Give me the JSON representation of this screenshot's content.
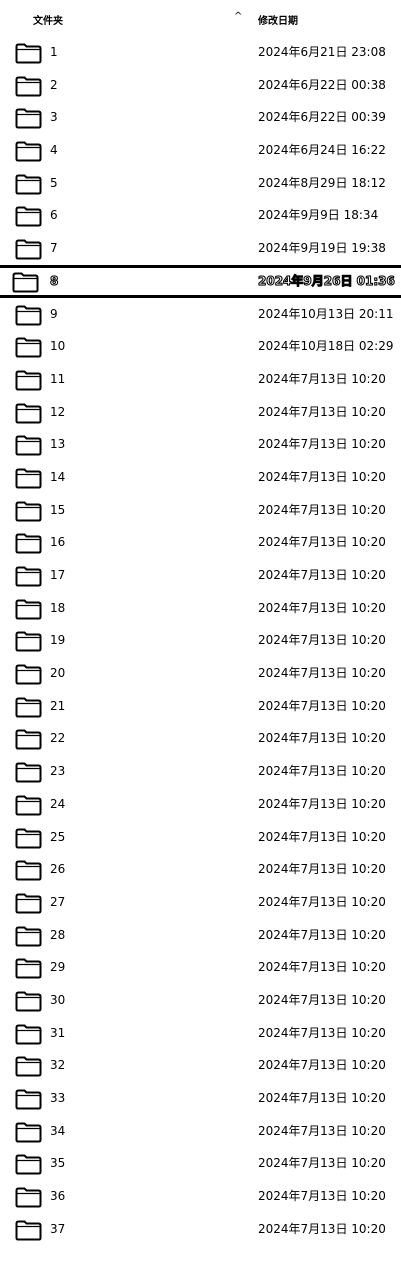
{
  "header": {
    "name_label": "文件夹",
    "sort_indicator": "^",
    "date_label": "修改日期"
  },
  "rows": [
    {
      "name": "1",
      "date": "2024年6月21日 23:08"
    },
    {
      "name": "2",
      "date": "2024年6月22日 00:38"
    },
    {
      "name": "3",
      "date": "2024年6月22日 00:39"
    },
    {
      "name": "4",
      "date": "2024年6月24日 16:22"
    },
    {
      "name": "5",
      "date": "2024年8月29日 18:12"
    },
    {
      "name": "6",
      "date": "2024年9月9日 18:34"
    },
    {
      "name": "7",
      "date": "2024年9月19日 19:38"
    },
    {
      "name": "8",
      "date": "2024年9月26日 01:36",
      "selected": true
    },
    {
      "name": "9",
      "date": "2024年10月13日 20:11"
    },
    {
      "name": "10",
      "date": "2024年10月18日 02:29"
    },
    {
      "name": "11",
      "date": "2024年7月13日 10:20"
    },
    {
      "name": "12",
      "date": "2024年7月13日 10:20"
    },
    {
      "name": "13",
      "date": "2024年7月13日 10:20"
    },
    {
      "name": "14",
      "date": "2024年7月13日 10:20"
    },
    {
      "name": "15",
      "date": "2024年7月13日 10:20"
    },
    {
      "name": "16",
      "date": "2024年7月13日 10:20"
    },
    {
      "name": "17",
      "date": "2024年7月13日 10:20"
    },
    {
      "name": "18",
      "date": "2024年7月13日 10:20"
    },
    {
      "name": "19",
      "date": "2024年7月13日 10:20"
    },
    {
      "name": "20",
      "date": "2024年7月13日 10:20"
    },
    {
      "name": "21",
      "date": "2024年7月13日 10:20"
    },
    {
      "name": "22",
      "date": "2024年7月13日 10:20"
    },
    {
      "name": "23",
      "date": "2024年7月13日 10:20"
    },
    {
      "name": "24",
      "date": "2024年7月13日 10:20"
    },
    {
      "name": "25",
      "date": "2024年7月13日 10:20"
    },
    {
      "name": "26",
      "date": "2024年7月13日 10:20"
    },
    {
      "name": "27",
      "date": "2024年7月13日 10:20"
    },
    {
      "name": "28",
      "date": "2024年7月13日 10:20"
    },
    {
      "name": "29",
      "date": "2024年7月13日 10:20"
    },
    {
      "name": "30",
      "date": "2024年7月13日 10:20"
    },
    {
      "name": "31",
      "date": "2024年7月13日 10:20"
    },
    {
      "name": "32",
      "date": "2024年7月13日 10:20"
    },
    {
      "name": "33",
      "date": "2024年7月13日 10:20"
    },
    {
      "name": "34",
      "date": "2024年7月13日 10:20"
    },
    {
      "name": "35",
      "date": "2024年7月13日 10:20"
    },
    {
      "name": "36",
      "date": "2024年7月13日 10:20"
    },
    {
      "name": "37",
      "date": "2024年7月13日 10:20"
    }
  ],
  "icons": {
    "folder": "folder-icon",
    "sort": "chevron-up-icon"
  }
}
